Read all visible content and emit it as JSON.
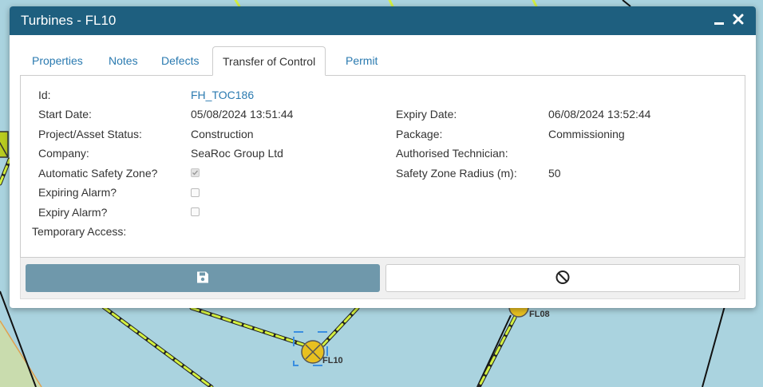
{
  "dialog": {
    "title": "Turbines - FL10",
    "minimize_icon": "minimize-icon",
    "close_icon": "close-icon"
  },
  "tabs": [
    {
      "label": "Properties"
    },
    {
      "label": "Notes"
    },
    {
      "label": "Defects"
    },
    {
      "label": "Transfer of Control"
    },
    {
      "label": "Permit"
    }
  ],
  "active_tab": "Transfer of Control",
  "form": {
    "id_label": "Id:",
    "id_value": "FH_TOC186",
    "start_date_label": "Start Date:",
    "start_date_value": "05/08/2024 13:51:44",
    "expiry_date_label": "Expiry Date:",
    "expiry_date_value": "06/08/2024 13:52:44",
    "status_label": "Project/Asset Status:",
    "status_value": "Construction",
    "package_label": "Package:",
    "package_value": "Commissioning",
    "company_label": "Company:",
    "company_value": "SeaRoc Group Ltd",
    "technician_label": "Authorised Technician:",
    "technician_value": "",
    "safety_zone_label": "Automatic Safety Zone?",
    "safety_zone_checked": true,
    "radius_label": "Safety Zone Radius (m):",
    "radius_value": "50",
    "expiring_alarm_label": "Expiring Alarm?",
    "expiring_alarm_checked": false,
    "expiry_alarm_label": "Expiry Alarm?",
    "expiry_alarm_checked": false,
    "temporary_access_label": "Temporary Access:"
  },
  "footer": {
    "save_icon": "save-icon",
    "cancel_icon": "cancel-icon"
  },
  "map": {
    "labels": [
      "FL10",
      "FL08"
    ]
  },
  "colors": {
    "titlebar": "#1e5f7f",
    "sea": "#aad3df",
    "land": "#c9dcae",
    "cable": "#d4f040",
    "turbine": "#e8c020",
    "save_button": "#6f98ab",
    "link": "#2a7ab0"
  }
}
